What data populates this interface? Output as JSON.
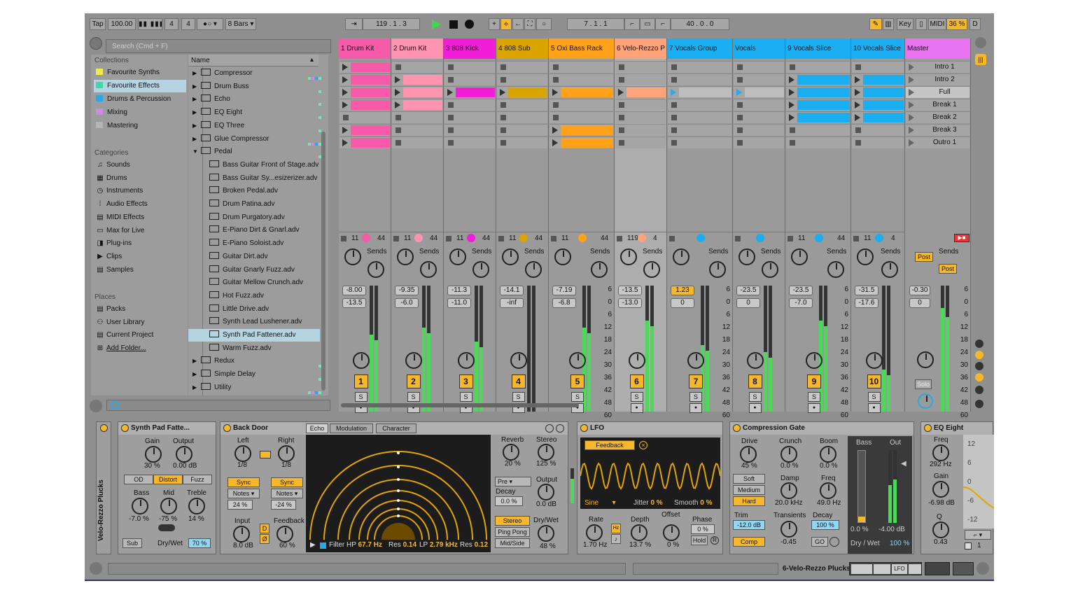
{
  "transport": {
    "tap": "Tap",
    "tempo": "100.00",
    "sig_num": "4",
    "sig_den": "4",
    "quant": "8 Bars",
    "position": "119 .  1 .  3",
    "loop_start": "7 .  1 .  1",
    "loop_len": "40 .  0 .  0",
    "key": "Key",
    "midi": "MIDI",
    "cpu": "36 %",
    "d": "D"
  },
  "browser": {
    "search_placeholder": "Search (Cmd + F)",
    "collections_header": "Collections",
    "collections": [
      {
        "label": "Favourite Synths",
        "color": "#f2e84a"
      },
      {
        "label": "Favourite Effects",
        "color": "#3fd7a6"
      },
      {
        "label": "Drums & Percussion",
        "color": "#2aa7e6"
      },
      {
        "label": "Mixing",
        "color": "#c98ce0"
      },
      {
        "label": "Mastering",
        "color": "#b5b5b5"
      }
    ],
    "categories_header": "Categories",
    "categories": [
      "Sounds",
      "Drums",
      "Instruments",
      "Audio Effects",
      "MIDI Effects",
      "Max for Live",
      "Plug-ins",
      "Clips",
      "Samples"
    ],
    "places_header": "Places",
    "places": [
      "Packs",
      "User Library",
      "Current Project",
      "Add Folder..."
    ],
    "name_header": "Name",
    "items": [
      {
        "label": "Compressor",
        "folder": true
      },
      {
        "label": "Drum Buss",
        "folder": true
      },
      {
        "label": "Echo",
        "folder": true
      },
      {
        "label": "EQ Eight",
        "folder": true
      },
      {
        "label": "EQ Three",
        "folder": true
      },
      {
        "label": "Glue Compressor",
        "folder": true
      },
      {
        "label": "Pedal",
        "folder": true,
        "open": true
      },
      {
        "label": "Bass Guitar Front of Stage.adv"
      },
      {
        "label": "Bass Guitar Sy...esizerizer.adv"
      },
      {
        "label": "Broken Pedal.adv"
      },
      {
        "label": "Drum Patina.adv"
      },
      {
        "label": "Drum Purgatory.adv"
      },
      {
        "label": "E-Piano Dirt & Gnarl.adv"
      },
      {
        "label": "E-Piano Soloist.adv"
      },
      {
        "label": "Guitar Dirt.adv"
      },
      {
        "label": "Guitar Gnarly Fuzz.adv"
      },
      {
        "label": "Guitar Mellow Crunch.adv"
      },
      {
        "label": "Hot Fuzz.adv"
      },
      {
        "label": "Little Drive.adv"
      },
      {
        "label": "Synth Lead Lushener.adv"
      },
      {
        "label": "Synth Pad Fattener.adv",
        "selected": true
      },
      {
        "label": "Warm Fuzz.adv"
      },
      {
        "label": "Redux",
        "folder": true
      },
      {
        "label": "Simple Delay",
        "folder": true
      },
      {
        "label": "Utility",
        "folder": true
      }
    ]
  },
  "tracks": [
    {
      "name": "1 Drum Kit",
      "color": "#f65aa8",
      "num": "1",
      "vol": "-8.00",
      "pan": "-13.5",
      "sends_label": "Sends",
      "left_val": "11",
      "right_val": "44",
      "clips": [
        1,
        1,
        1,
        1,
        0,
        1,
        1
      ]
    },
    {
      "name": "2 Drum Kit",
      "color": "#ff94b0",
      "num": "2",
      "vol": "-9.35",
      "pan": "-6.0",
      "sends_label": "Sends",
      "left_val": "11",
      "right_val": "44",
      "clips": [
        0,
        1,
        1,
        1,
        0,
        0,
        0
      ]
    },
    {
      "name": "3 808 Kick",
      "color": "#f21ed7",
      "num": "3",
      "vol": "-11.3",
      "pan": "-11.0",
      "sends_label": "Sends",
      "left_val": "11",
      "right_val": "44",
      "clips": [
        0,
        0,
        1,
        0,
        0,
        0,
        0
      ]
    },
    {
      "name": "4 808 Sub",
      "color": "#d9a300",
      "num": "4",
      "vol": "-14.1",
      "pan": "-inf",
      "sends_label": "Sends",
      "left_val": "11",
      "right_val": "44",
      "clips": [
        0,
        0,
        1,
        0,
        0,
        0,
        0
      ]
    },
    {
      "name": "5 Oxi Bass Rack",
      "color": "#ffa21a",
      "num": "5",
      "vol": "-7.19",
      "pan": "-6.8",
      "sends_label": "Sends",
      "left_val": "11",
      "right_val": "44",
      "clips": [
        0,
        0,
        1,
        0,
        0,
        1,
        1
      ]
    },
    {
      "name": "6 Velo-Rezzo P",
      "color": "#ffa37a",
      "num": "6",
      "vol": "-13.5",
      "pan": "-13.0",
      "sends_label": "Sends",
      "left_val": "119",
      "right_val": "4",
      "clips": [
        0,
        0,
        1,
        0,
        0,
        0,
        0
      ]
    },
    {
      "name": "7 Vocals Group",
      "color": "#1aaef0",
      "num": "7",
      "vol": "1.23",
      "pan": "0",
      "sends_label": "Sends",
      "left_val": "",
      "right_val": "",
      "clips": [
        0,
        0,
        2,
        0,
        0,
        0,
        0
      ]
    },
    {
      "name": "Vocals",
      "color": "#1aaef0",
      "num": "8",
      "vol": "-23.5",
      "pan": "0",
      "sends_label": "Sends",
      "left_val": "",
      "right_val": "",
      "clips": [
        0,
        0,
        2,
        0,
        0,
        0,
        0
      ]
    },
    {
      "name": "9 Vocals Slice",
      "color": "#1aaef0",
      "num": "9",
      "vol": "-23.5",
      "pan": "-7.0",
      "sends_label": "Sends",
      "left_val": "11",
      "right_val": "44",
      "clips": [
        0,
        1,
        1,
        1,
        1,
        0,
        0
      ]
    },
    {
      "name": "10 Vocals Slice",
      "color": "#1aaef0",
      "num": "10",
      "vol": "-31.5",
      "pan": "-17.6",
      "sends_label": "Sends",
      "left_val": "11",
      "right_val": "4",
      "clips": [
        0,
        1,
        1,
        1,
        1,
        0,
        0
      ]
    }
  ],
  "master": {
    "name": "Master",
    "color": "#e874f2",
    "vol": "-0.30",
    "pan": "0",
    "sends_label": "Sends",
    "post1": "Post",
    "post2": "Post",
    "solo": "Solo",
    "scenes": [
      "Intro 1",
      "Intro 2",
      "Full",
      "Break 1",
      "Break 2",
      "Break 3",
      "Outro 1"
    ]
  },
  "meter_ticks": [
    "6",
    "0",
    "6",
    "12",
    "18",
    "24",
    "30",
    "36",
    "42",
    "48",
    "60"
  ],
  "devices": {
    "rack_name": "Velo-Rezzo Plucks",
    "synthpad": {
      "title": "Synth Pad Fatte...",
      "gain_label": "Gain",
      "gain": "30 %",
      "output_label": "Output",
      "output": "0.00 dB",
      "modes": [
        "OD",
        "Distort",
        "Fuzz"
      ],
      "bass_label": "Bass",
      "bass": "-7.0 %",
      "mid_label": "Mid",
      "mid": "-75 %",
      "treble_label": "Treble",
      "treble": "14 %",
      "sub": "Sub",
      "drywet_label": "Dry/Wet",
      "drywet": "70 %"
    },
    "backdoor": {
      "title": "Back Door",
      "left_label": "Left",
      "left": "1/8",
      "right_label": "Right",
      "right": "1/8",
      "sync": "Sync",
      "notes": "Notes",
      "l_pct": "24 %",
      "r_pct": "-24 %",
      "input_label": "Input",
      "input": "8.0 dB",
      "feedback_label": "Feedback",
      "feedback": "60 %",
      "d": "D",
      "o": "Ø"
    },
    "echo": {
      "tabs": [
        "Echo",
        "Modulation",
        "Character"
      ],
      "filter": "Filter HP",
      "hp": "67.7 Hz",
      "res1_label": "Res",
      "res1": "0.14",
      "lp_label": "LP",
      "lp": "2.79 kHz",
      "res2_label": "Res",
      "res2": "0.12",
      "reverb_label": "Reverb",
      "reverb": "20 %",
      "stereo_label": "Stereo",
      "stereo": "125 %",
      "pre": "Pre",
      "decay_label": "Decay",
      "decay": "0.0 %",
      "output_label": "Output",
      "output": "0.0 dB",
      "modes": [
        "Stereo",
        "Ping Pong",
        "Mid/Side"
      ],
      "drywet_label": "Dry/Wet",
      "drywet": "48 %"
    },
    "lfo": {
      "title": "LFO",
      "feedback": "Feedback",
      "wave": "Sine",
      "jitter_label": "Jitter",
      "jitter": "0 %",
      "smooth_label": "Smooth",
      "smooth": "0 %",
      "rate_label": "Rate",
      "rate": "1.70 Hz",
      "depth_label": "Depth",
      "depth": "13.7 %",
      "offset_label": "Offset",
      "offset": "0 %",
      "phase_label": "Phase",
      "phase": "0 %",
      "hold": "Hold",
      "r": "R",
      "hz": "Hz"
    },
    "comp": {
      "title": "Compression Gate",
      "drive_label": "Drive",
      "drive": "45 %",
      "crunch_label": "Crunch",
      "crunch": "0.0 %",
      "boom_label": "Boom",
      "boom": "0.0 %",
      "modes": [
        "Soft",
        "Medium",
        "Hard"
      ],
      "damp_label": "Damp",
      "damp": "20.0 kHz",
      "freq_label": "Freq",
      "freq": "49.0 Hz",
      "trim_label": "Trim",
      "trim": "-12.0 dB",
      "transients_label": "Transients",
      "transients": "-0.45",
      "decay_label": "Decay",
      "decay": "100 %",
      "go": "GO",
      "comp": "Comp",
      "bass_label": "Bass",
      "out_label": "Out",
      "bass_val": "0.0 %",
      "out_val": "-4.00 dB",
      "drywet_label": "Dry / Wet",
      "drywet": "100 %"
    },
    "eq": {
      "title": "EQ Eight",
      "freq_label": "Freq",
      "freq": "292 Hz",
      "gain_label": "Gain",
      "gain": "-6.98 dB",
      "q_label": "Q",
      "q": "0.43",
      "ticks": [
        "12",
        "6",
        "0",
        "-6",
        "-12"
      ],
      "band": "1"
    }
  },
  "status": {
    "track_name": "6-Velo-Rezzo Plucks",
    "lfo_mini": "LFO"
  }
}
